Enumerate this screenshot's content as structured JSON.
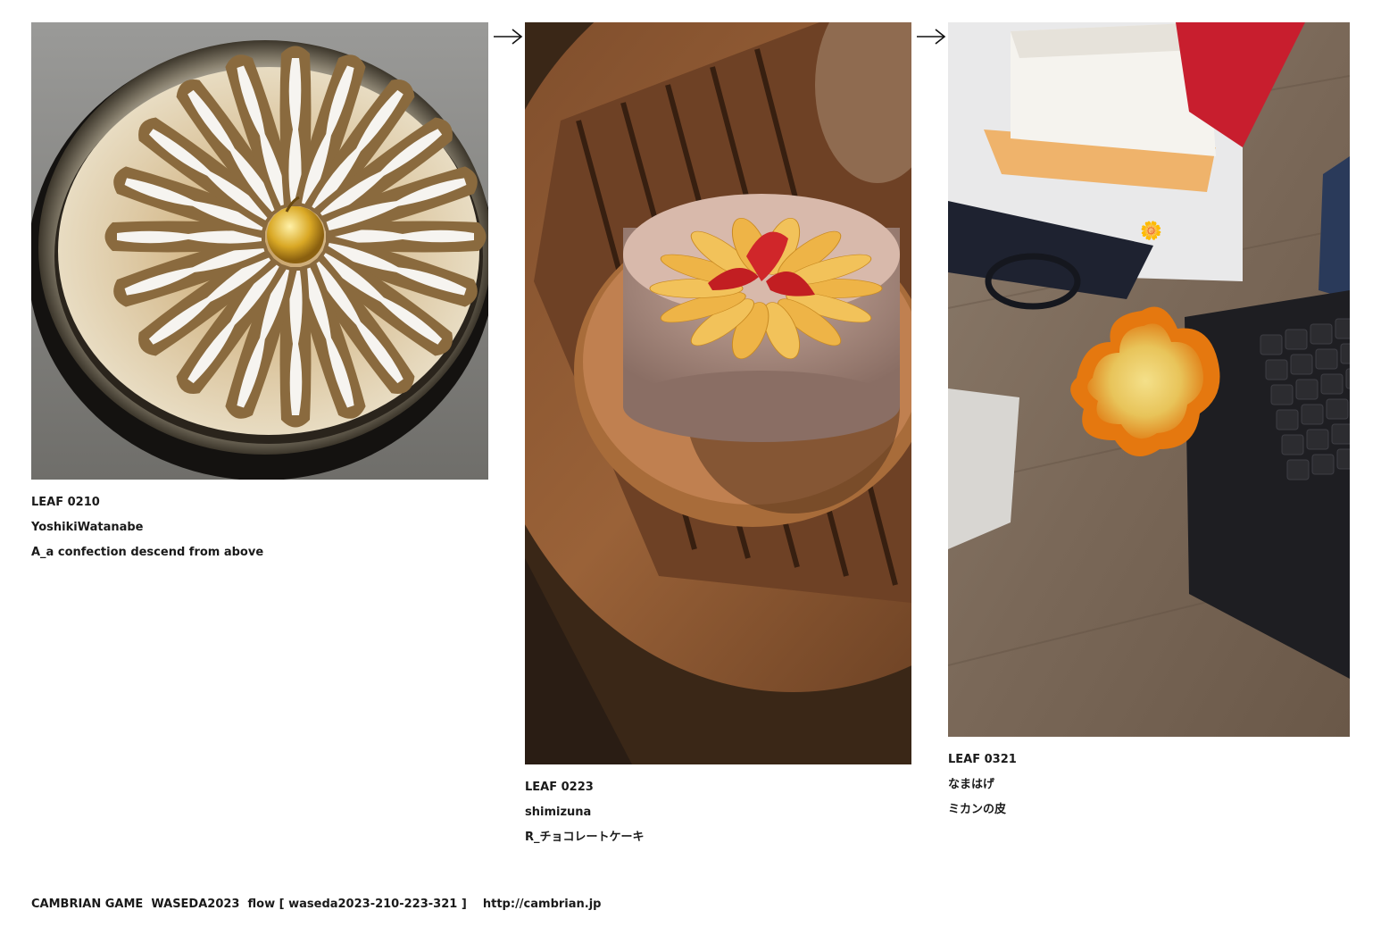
{
  "leaves": [
    {
      "id": "LEAF 0210",
      "author": "YoshikiWatanabe",
      "title": "A_a confection descend from above",
      "image_alt": "cake with sugared fingers arranged radially in a metal pan"
    },
    {
      "id": "LEAF 0223",
      "author": "shimizuna",
      "title": "R_チョコレートケーキ",
      "image_alt": "chocolate cake topped with orange segments and strawberry on a wooden table"
    },
    {
      "id": "LEAF 0321",
      "author": "なまはげ",
      "title": "ミカンの皮",
      "image_alt": "peeled mandarin orange skin on a desk beside a keyboard"
    }
  ],
  "footer": {
    "game": "CAMBRIAN GAME",
    "event": "WASEDA2023",
    "flow": "flow [ waseda2023-210-223-321 ]",
    "url": "http://cambrian.jp"
  },
  "icons": {
    "arrow": "arrow-right-icon",
    "flower": "flower-icon"
  },
  "flower_glyph": "🌼"
}
